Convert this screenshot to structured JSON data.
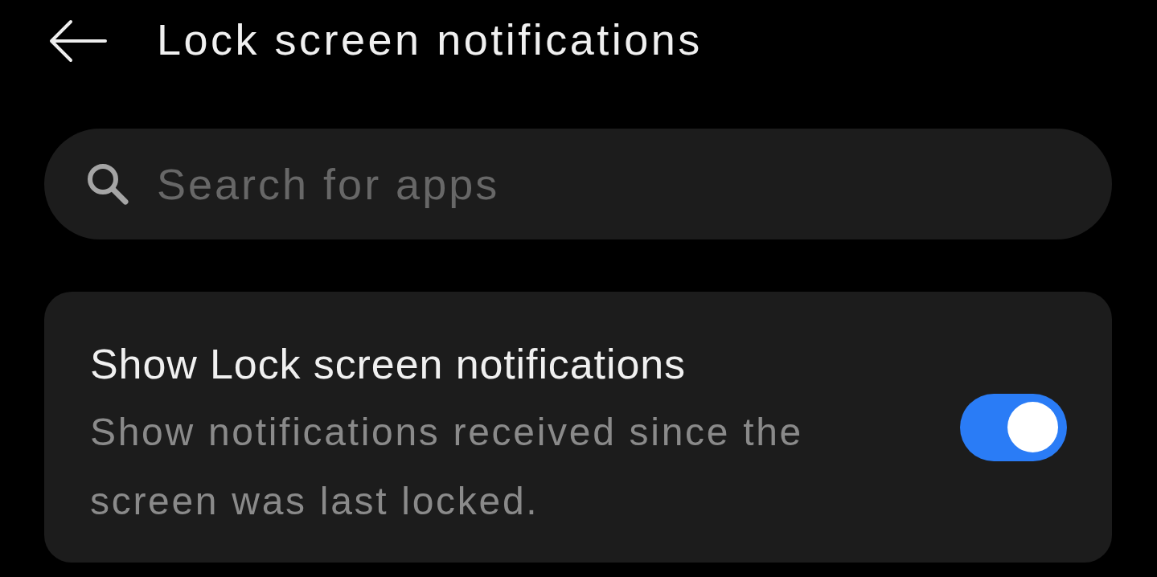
{
  "header": {
    "title": "Lock screen notifications"
  },
  "search": {
    "placeholder": "Search for apps"
  },
  "settings": [
    {
      "kind": "toggle",
      "title": "Show Lock screen notifications",
      "description": "Show notifications received since the screen was last locked.",
      "on": true
    }
  ]
}
